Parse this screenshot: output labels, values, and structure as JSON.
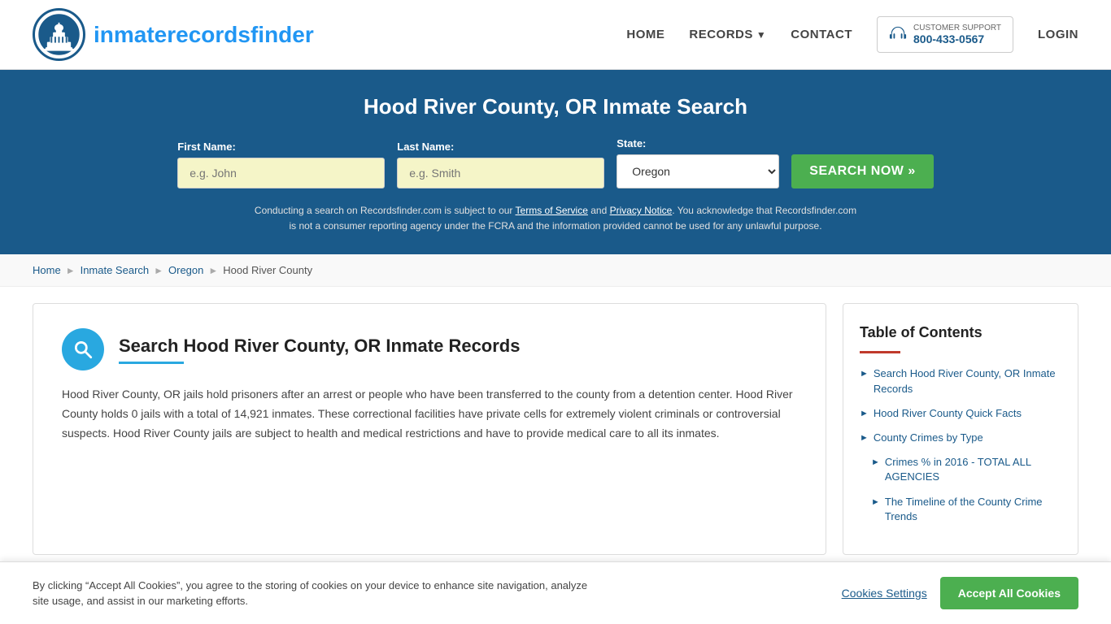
{
  "header": {
    "logo_text_part1": "inmaterecords",
    "logo_text_part2": "finder",
    "nav": {
      "home": "HOME",
      "records": "RECORDS",
      "contact": "CONTACT",
      "support_label": "CUSTOMER SUPPORT",
      "support_phone": "800-433-0567",
      "login": "LOGIN"
    }
  },
  "banner": {
    "title": "Hood River County, OR Inmate Search",
    "first_name_label": "First Name:",
    "first_name_placeholder": "e.g. John",
    "last_name_label": "Last Name:",
    "last_name_placeholder": "e.g. Smith",
    "state_label": "State:",
    "state_value": "Oregon",
    "search_button": "SEARCH NOW »",
    "disclaimer": "Conducting a search on Recordsfinder.com is subject to our Terms of Service and Privacy Notice. You acknowledge that Recordsfinder.com is not a consumer reporting agency under the FCRA and the information provided cannot be used for any unlawful purpose."
  },
  "breadcrumb": {
    "home": "Home",
    "inmate_search": "Inmate Search",
    "oregon": "Oregon",
    "current": "Hood River County"
  },
  "content": {
    "title": "Search Hood River County, OR Inmate Records",
    "body": "Hood River County, OR jails hold prisoners after an arrest or people who have been transferred to the county from a detention center. Hood River County holds 0 jails with a total of 14,921 inmates. These correctional facilities have private cells for extremely violent criminals or controversial suspects. Hood River County jails are subject to health and medical restrictions and have to provide medical care to all its inmates."
  },
  "toc": {
    "title": "Table of Contents",
    "items": [
      {
        "label": "Search Hood River County, OR Inmate Records",
        "sub": false
      },
      {
        "label": "Hood River County Quick Facts",
        "sub": false
      },
      {
        "label": "County Crimes by Type",
        "sub": false
      },
      {
        "label": "Crimes % in 2016 - TOTAL ALL AGENCIES",
        "sub": true
      },
      {
        "label": "The Timeline of the County Crime Trends",
        "sub": true
      }
    ]
  },
  "cookie_banner": {
    "text": "By clicking “Accept All Cookies”, you agree to the storing of cookies on your device to enhance site navigation, analyze site usage, and assist in our marketing efforts.",
    "settings_label": "Cookies Settings",
    "accept_label": "Accept All Cookies"
  }
}
